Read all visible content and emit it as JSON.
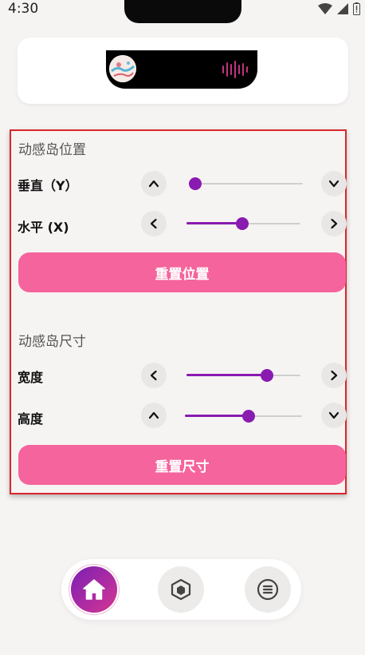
{
  "status_bar": {
    "time": "4:30",
    "icons": [
      "wifi-icon",
      "signal-icon",
      "battery-icon"
    ]
  },
  "position_section": {
    "title": "动感岛位置",
    "vertical": {
      "label": "垂直（Y）",
      "value": 0.0,
      "minus_icon": "chevron-up-icon",
      "plus_icon": "chevron-down-icon"
    },
    "horizontal": {
      "label": "水平 (X)",
      "value": 0.49,
      "minus_icon": "chevron-left-icon",
      "plus_icon": "chevron-right-icon"
    },
    "reset_label": "重置位置"
  },
  "size_section": {
    "title": "动感岛尺寸",
    "width": {
      "label": "宽度",
      "value": 0.73,
      "minus_icon": "chevron-left-icon",
      "plus_icon": "chevron-right-icon"
    },
    "height": {
      "label": "高度",
      "value": 0.55,
      "minus_icon": "chevron-up-icon",
      "plus_icon": "chevron-down-icon"
    },
    "reset_label": "重置尺寸"
  },
  "nav": {
    "items": [
      "home-icon",
      "cube-icon",
      "menu-icon"
    ],
    "active": 0
  },
  "colors": {
    "accent": "#8a1bb0",
    "button": "#f5649c",
    "highlight_border": "#d9262a"
  }
}
